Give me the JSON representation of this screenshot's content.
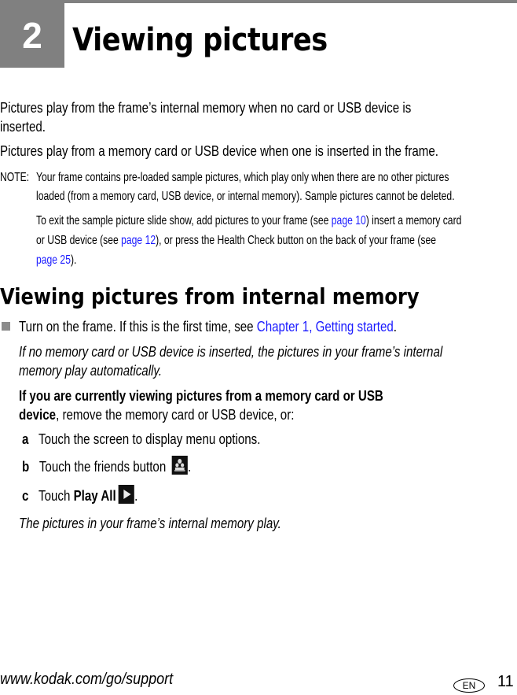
{
  "chapter": {
    "number": "2",
    "title": "Viewing pictures"
  },
  "intro": {
    "line1": "Pictures play from the frame’s internal memory when no card or USB device is",
    "line2": "inserted.",
    "line3": "Pictures play from a memory card or USB device when one is inserted in the frame."
  },
  "note": {
    "label": "NOTE:",
    "line1": "Your frame contains pre-loaded sample pictures, which play only when there are no other pictures",
    "line2": "loaded (from a memory card, USB device, or internal memory). Sample pictures cannot be deleted.",
    "p2_a": "To exit the sample picture slide show, add pictures to your frame (see ",
    "p2_link1": "page 10",
    "p2_b": ") insert a memory card",
    "p2_c": "or USB device (see ",
    "p2_link2": "page 12",
    "p2_d": "), or press the Health Check button on the back of your frame (see",
    "p2_link3": "page 25",
    "p2_e": ")."
  },
  "section": {
    "heading": "Viewing pictures from internal memory",
    "bullet_text": "Turn on the frame. If this is the first time, see ",
    "bullet_link": "Chapter 1, Getting started",
    "bullet_end": ".",
    "italic1_line1": "If no memory card or USB device is inserted, the pictures in your frame’s internal",
    "italic1_line2": "memory play automatically.",
    "bold_line1": "If you are currently viewing pictures from a memory card or USB",
    "bold_line2_bold": "device",
    "bold_line2_rest": ", remove the memory card or USB device, or:",
    "steps": [
      {
        "letter": "a",
        "text": "Touch the screen to display menu options."
      },
      {
        "letter": "b",
        "text": "Touch the friends button ",
        "icon": "friends-icon",
        "end": "."
      },
      {
        "letter": "c",
        "text": "Touch ",
        "bold": "Play All",
        "icon": "play-icon",
        "end": "."
      }
    ],
    "italic2": "The pictures in your frame’s internal memory play."
  },
  "footer": {
    "url": "www.kodak.com/go/support",
    "lang": "EN",
    "page": "11"
  },
  "colors": {
    "link": "#1a1aff",
    "chapter_box": "#808080"
  }
}
